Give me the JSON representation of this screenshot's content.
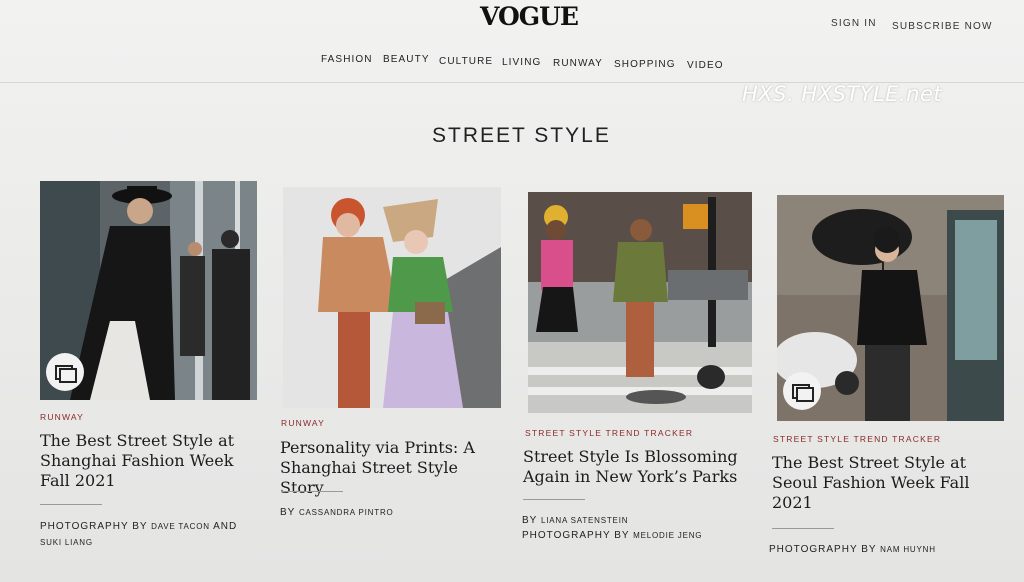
{
  "header": {
    "logo": "VOGUE",
    "sign_in": "SIGN IN",
    "subscribe": "SUBSCRIBE NOW"
  },
  "nav": [
    "FASHION",
    "BEAUTY",
    "CULTURE",
    "LIVING",
    "RUNWAY",
    "SHOPPING",
    "VIDEO"
  ],
  "watermark": "HXS. HXSTYLE.net",
  "section_title": "STREET STYLE",
  "cards": [
    {
      "category": "RUNWAY",
      "headline": "The Best Street Style at Shanghai Fashion Week Fall 2021",
      "credit1_prefix": "PHOTOGRAPHY BY",
      "credit1_name": "DAVE TACON",
      "credit1_suffix": "AND",
      "credit2_name": "SUKI LIANG",
      "has_gallery": true
    },
    {
      "category": "RUNWAY",
      "headline": "Personality via Prints: A Shanghai Street Style Story",
      "credit1_prefix": "BY",
      "credit1_name": "CASSANDRA PINTRO",
      "has_gallery": false
    },
    {
      "category": "STREET STYLE TREND TRACKER",
      "headline": "Street Style Is Blossoming Again in New York’s Parks",
      "credit1_prefix": "BY",
      "credit1_name": "LIANA SATENSTEIN",
      "credit2_prefix": "PHOTOGRAPHY BY",
      "credit2_name": "MELODIE JENG",
      "has_gallery": false
    },
    {
      "category": "STREET STYLE TREND TRACKER",
      "headline": "The Best Street Style at Seoul Fashion Week Fall 2021",
      "credit1_prefix": "PHOTOGRAPHY BY",
      "credit1_name": "NAM HUYNH",
      "has_gallery": true
    }
  ],
  "icons": {
    "gallery": "gallery-icon"
  }
}
